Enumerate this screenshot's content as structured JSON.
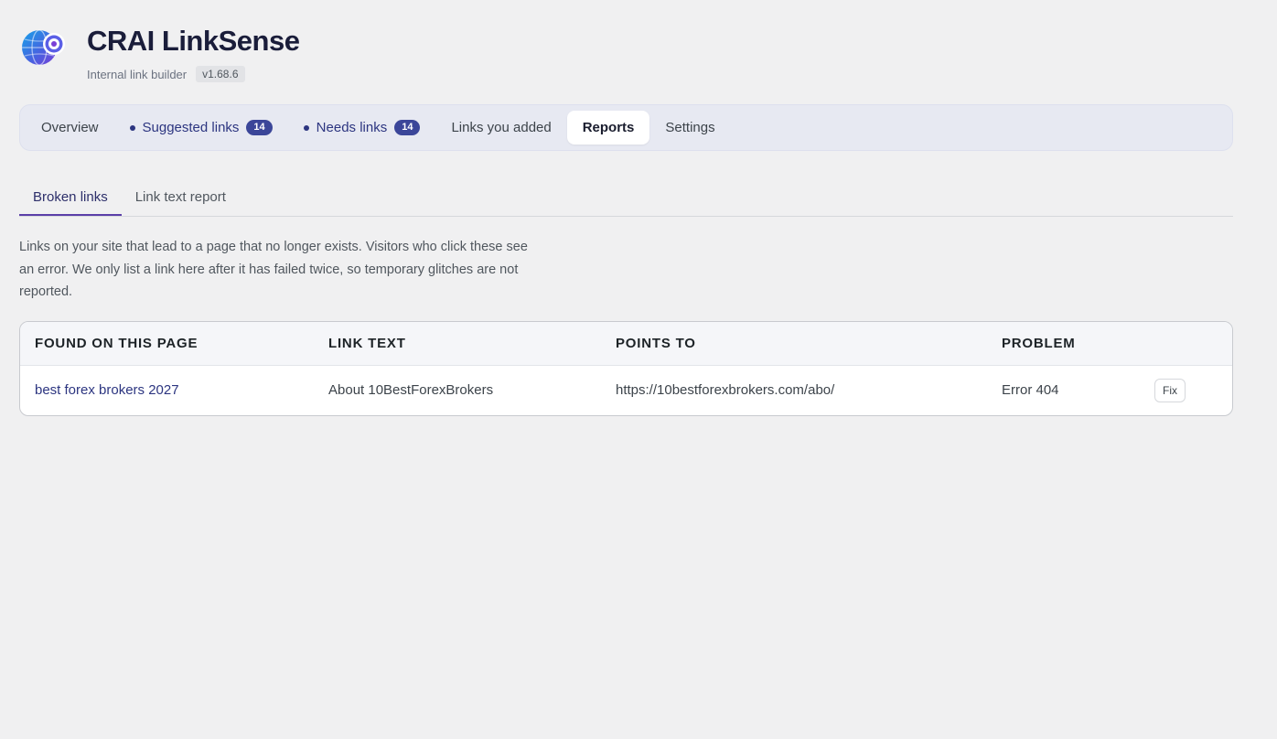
{
  "header": {
    "title": "CRAI LinkSense",
    "subtitle": "Internal link builder",
    "version": "v1.68.6",
    "logo_icon": "globe-target-logo"
  },
  "tabs": [
    {
      "label": "Overview"
    },
    {
      "label": "Suggested links",
      "badge": "14"
    },
    {
      "label": "Needs links",
      "badge": "14"
    },
    {
      "label": "Links you added"
    },
    {
      "label": "Reports",
      "active": true
    },
    {
      "label": "Settings"
    }
  ],
  "subtabs": [
    {
      "label": "Broken links",
      "active": true
    },
    {
      "label": "Link text report"
    }
  ],
  "description": "Links on your site that lead to a page that no longer exists. Visitors who click these see an error. We only list a link here after it has failed twice, so temporary glitches are not reported.",
  "table": {
    "columns": [
      "FOUND ON THIS PAGE",
      "LINK TEXT",
      "POINTS TO",
      "PROBLEM"
    ],
    "rows": [
      {
        "found_on": "best forex brokers 2027",
        "link_text": "About 10BestForexBrokers",
        "points_to": "https://10bestforexbrokers.com/abo/",
        "problem": "Error 404",
        "action": "Fix"
      }
    ]
  },
  "colors": {
    "accent": "#2c3580",
    "badge": "#3b4699",
    "subtab_underline": "#5b3fa8",
    "background": "#f0f0f1"
  }
}
